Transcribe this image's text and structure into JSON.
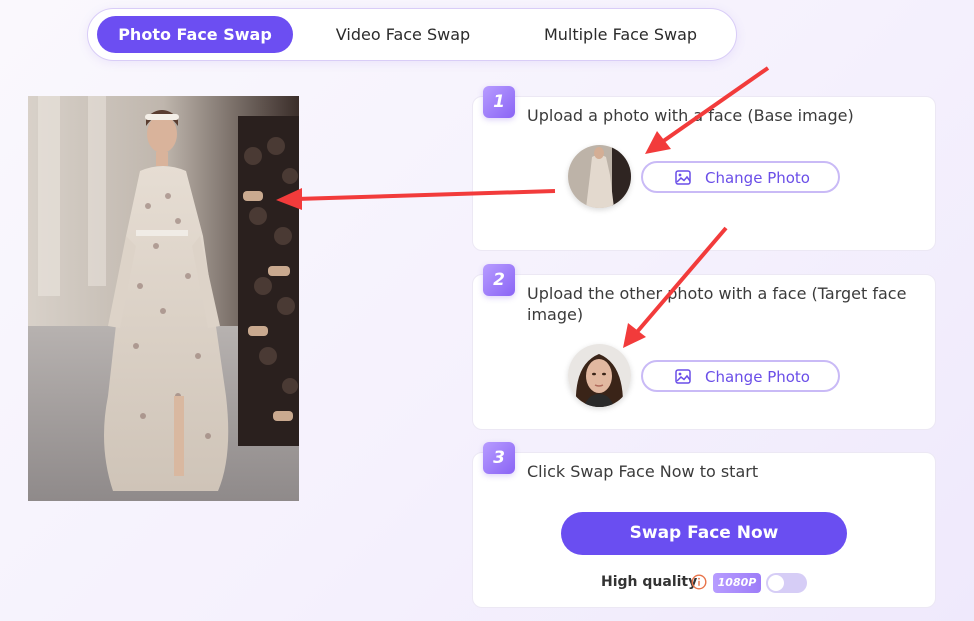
{
  "tabs": [
    {
      "label": "Photo Face Swap",
      "active": true
    },
    {
      "label": "Video Face Swap",
      "active": false
    },
    {
      "label": "Multiple Face Swap",
      "active": false
    }
  ],
  "steps": [
    {
      "number": "1",
      "text": "Upload a photo with a face (Base image)",
      "button": "Change Photo"
    },
    {
      "number": "2",
      "text": "Upload the other photo with a face (Target face image)",
      "button": "Change Photo"
    },
    {
      "number": "3",
      "text": "Click Swap Face Now to start"
    }
  ],
  "swap_button": "Swap Face Now",
  "quality": {
    "label": "High quality",
    "badge": "1080P",
    "info_icon": "info-circle-icon",
    "toggle_on": false
  },
  "colors": {
    "accent": "#6c4ef2",
    "annotation_arrow": "#f23b3b"
  }
}
